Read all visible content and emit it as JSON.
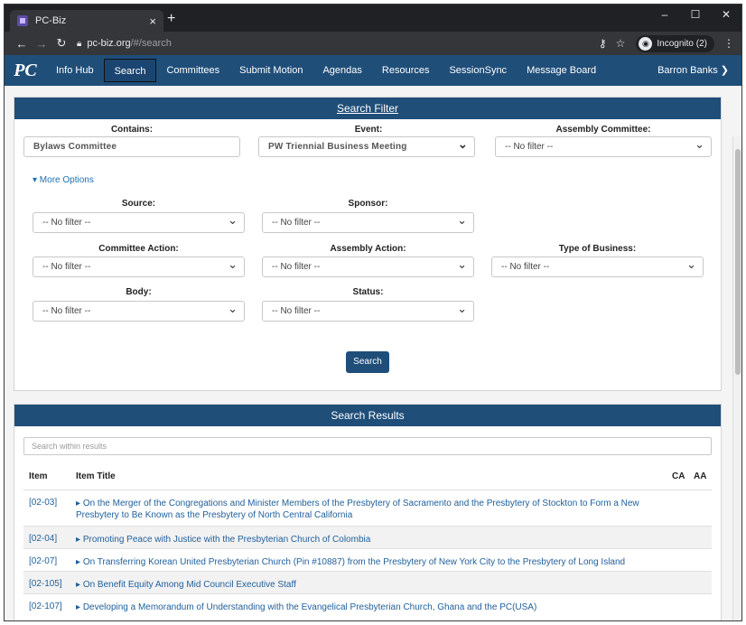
{
  "browser": {
    "tab_title": "PC-Biz",
    "tab_close": "×",
    "new_tab": "+",
    "window_controls": [
      "–",
      "☐",
      "✕"
    ],
    "url_domain": "pc-biz.org",
    "url_path": "/#/search",
    "incognito_label": "Incognito (2)",
    "icons": [
      "back-icon",
      "forward-icon",
      "reload-icon",
      "lock-icon",
      "key-icon",
      "star-icon",
      "incognito-icon",
      "menu-icon"
    ]
  },
  "site_nav": {
    "logo": "PC",
    "items": [
      "Info Hub",
      "Search",
      "Committees",
      "Submit Motion",
      "Agendas",
      "Resources",
      "SessionSync",
      "Message Board"
    ],
    "active": "Search",
    "user": "Barron Banks ❯"
  },
  "search_filter": {
    "header": "Search Filter",
    "contains_label": "Contains:",
    "contains_value": "Bylaws Committee",
    "event_label": "Event:",
    "event_value": "PW Triennial Business Meeting",
    "assembly_committee_label": "Assembly Committee:",
    "assembly_committee_value": "-- No filter --",
    "more_options": "▾ More Options",
    "source_label": "Source:",
    "source_value": "-- No filter --",
    "sponsor_label": "Sponsor:",
    "sponsor_value": "-- No filter --",
    "committee_action_label": "Committee Action:",
    "committee_action_value": "-- No filter --",
    "assembly_action_label": "Assembly Action:",
    "assembly_action_value": "-- No filter --",
    "type_of_business_label": "Type of Business:",
    "type_of_business_value": "-- No filter --",
    "body_label": "Body:",
    "body_value": "-- No filter --",
    "status_label": "Status:",
    "status_value": "-- No filter --",
    "search_button": "Search"
  },
  "results": {
    "header": "Search Results",
    "within_placeholder": "Search within results",
    "col_item": "Item",
    "col_title": "Item Title",
    "col_ca": "CA",
    "col_aa": "AA",
    "rows": [
      {
        "item": "[02-03]",
        "title": "On the Merger of the Congregations and Minister Members of the Presbytery of Sacramento and the Presbytery of Stockton to Form a New Presbytery to Be Known as the Presbytery of North Central California"
      },
      {
        "item": "[02-04]",
        "title": "Promoting Peace with Justice with the Presbyterian Church of Colombia"
      },
      {
        "item": "[02-07]",
        "title": "On Transferring Korean United Presbyterian Church (Pin #10887) from the Presbytery of New York City to the Presbytery of Long Island"
      },
      {
        "item": "[02-105]",
        "title": "On Benefit Equity Among Mid Council Executive Staff"
      },
      {
        "item": "[02-107]",
        "title": "Developing a Memorandum of Understanding with the Evangelical Presbyterian Church, Ghana and the PC(USA)"
      }
    ]
  }
}
